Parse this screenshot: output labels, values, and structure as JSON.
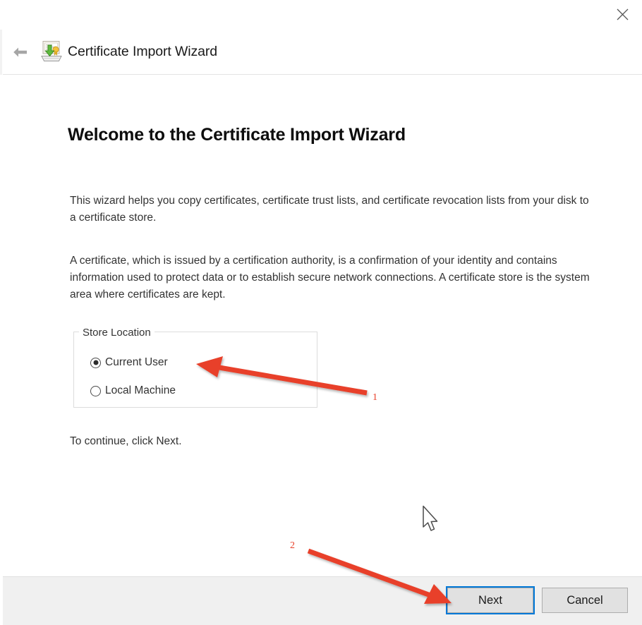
{
  "window": {
    "close_label": "✕",
    "back_label": "←"
  },
  "header": {
    "icon": "certificate-import-icon",
    "title": "Certificate Import Wizard"
  },
  "main": {
    "heading": "Welcome to the Certificate Import Wizard",
    "paragraph_1": "This wizard helps you copy certificates, certificate trust lists, and certificate revocation lists from your disk to a certificate store.",
    "paragraph_2": "A certificate, which is issued by a certification authority, is a confirmation of your identity and contains information used to protect data or to establish secure network connections. A certificate store is the system area where certificates are kept.",
    "continue_text": "To continue, click Next.",
    "store_location": {
      "legend": "Store Location",
      "options": [
        {
          "label": "Current User",
          "selected": true
        },
        {
          "label": "Local Machine",
          "selected": false
        }
      ]
    }
  },
  "footer": {
    "next_label": "Next",
    "cancel_label": "Cancel"
  },
  "annotations": [
    {
      "number": "1",
      "target": "current-user-radio"
    },
    {
      "number": "2",
      "target": "next-button"
    }
  ],
  "colors": {
    "annotation": "#E8402A",
    "focus_border": "#0078D7",
    "footer_background": "#F0F0F0",
    "button_face": "#E1E1E1",
    "text": "#333333"
  }
}
